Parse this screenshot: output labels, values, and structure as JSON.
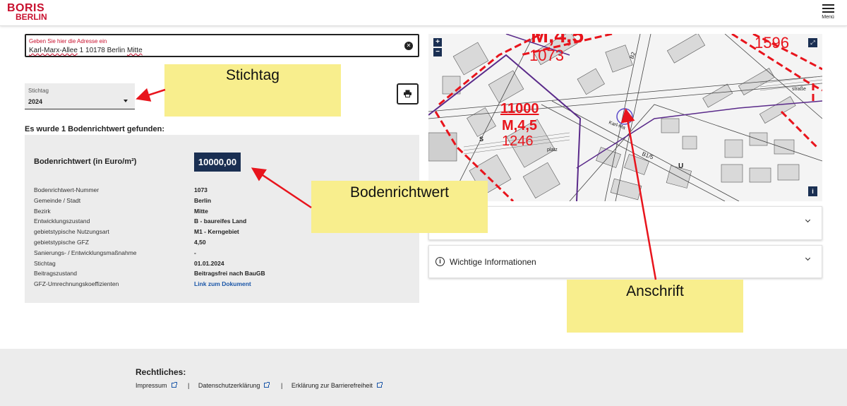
{
  "header": {
    "logo_top": "BORIS",
    "logo_bottom": "BERLIN",
    "menu_label": "Menü"
  },
  "address": {
    "label": "Geben Sie hier die Adresse ein",
    "value_part1": "Karl-Marx-Allee",
    "value_part2": " 1 10178 Berlin ",
    "value_part3": "Mitte"
  },
  "stichtag_select": {
    "label": "Stichtag",
    "value": "2024"
  },
  "annotations": {
    "stichtag": "Stichtag",
    "bodenrichtwert": "Bodenrichtwert",
    "anschrift": "Anschrift",
    "color": "#f8ee8d",
    "arrow_color": "#e8141c"
  },
  "result": {
    "found_text": "Es wurde 1 Bodenrichtwert gefunden:",
    "brw_label": "Bodenrichtwert (in Euro/m²)",
    "brw_value": "10000,00",
    "rows": [
      {
        "key": "Bodenrichtwert-Nummer",
        "value": "1073"
      },
      {
        "key": "Gemeinde / Stadt",
        "value": "Berlin"
      },
      {
        "key": "Bezirk",
        "value": "Mitte"
      },
      {
        "key": "Entwicklungszustand",
        "value": "B - baureifes Land"
      },
      {
        "key": "gebietstypische Nutzungsart",
        "value": "M1 - Kerngebiet"
      },
      {
        "key": "gebietstypische GFZ",
        "value": "4,50"
      },
      {
        "key": "Sanierungs- / Entwicklungsmaßnahme",
        "value": "-"
      },
      {
        "key": "Stichtag",
        "value": "01.01.2024"
      },
      {
        "key": "Beitragszustand",
        "value": "Beitragsfrei nach BauGB"
      },
      {
        "key": "GFZ-Umrechnungskoeffizienten",
        "value": "Link zum Dokument"
      }
    ]
  },
  "map": {
    "zoom_in": "+",
    "zoom_out": "−",
    "fullscreen_icon": "expand-icon",
    "info": "i",
    "labels": {
      "top_gfz": "M,4,5",
      "top_num": "1073",
      "top_right_num": "1596",
      "center_value": "11000",
      "center_gfz": "M,4,5",
      "center_num": "1246",
      "street_b2": "B2",
      "street_b15": "B1/5",
      "street_karl": "Karl-Ma",
      "street_stra": "straße",
      "station_u": "U",
      "station_s": "S",
      "platz": "platz"
    },
    "boundary_color": "#e8141c",
    "purple_line_color": "#5a2a8a"
  },
  "panels": {
    "panel1_title": "",
    "panel2_title": "Wichtige Informationen"
  },
  "footer": {
    "title": "Rechtliches:",
    "impressum": "Impressum",
    "datenschutz": "Datenschutzerklärung",
    "barriere": "Erklärung zur Barrierefreiheit",
    "separator": "|"
  }
}
